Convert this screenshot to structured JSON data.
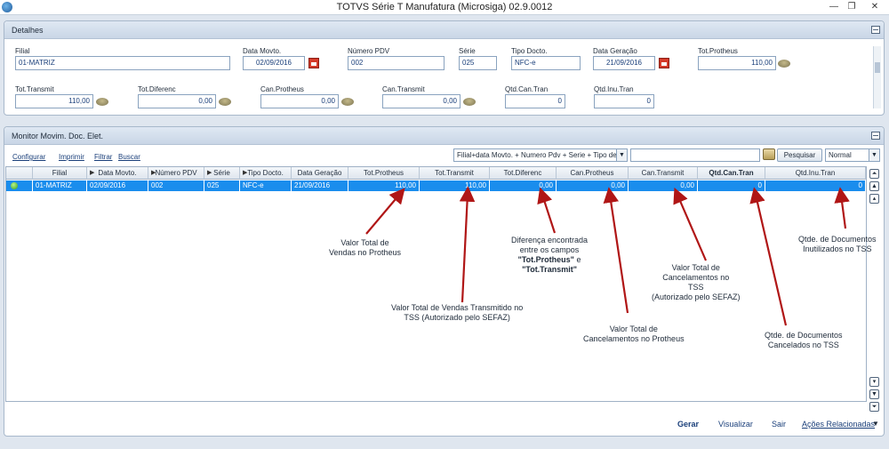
{
  "window": {
    "title": "TOTVS Série T Manufatura (Microsiga) 02.9.0012",
    "minimize": "—",
    "restore": "❐",
    "close": "✕"
  },
  "details": {
    "title": "Detalhes",
    "fields": {
      "filial": {
        "label": "Filial",
        "value": "01-MATRIZ"
      },
      "data_movto": {
        "label": "Data Movto.",
        "value": "02/09/2016"
      },
      "numero_pdv": {
        "label": "Número PDV",
        "value": "002"
      },
      "serie": {
        "label": "Série",
        "value": "025"
      },
      "tipo_docto": {
        "label": "Tipo Docto.",
        "value": "NFC-e"
      },
      "data_geracao": {
        "label": "Data Geração",
        "value": "21/09/2016"
      },
      "tot_protheus": {
        "label": "Tot.Protheus",
        "value": "110,00"
      },
      "tot_transmit": {
        "label": "Tot.Transmit",
        "value": "110,00"
      },
      "tot_diferenc": {
        "label": "Tot.Diferenc",
        "value": "0,00"
      },
      "can_protheus": {
        "label": "Can.Protheus",
        "value": "0,00"
      },
      "can_transmit": {
        "label": "Can.Transmit",
        "value": "0,00"
      },
      "qtd_can_tran": {
        "label": "Qtd.Can.Tran",
        "value": "0"
      },
      "qtd_inu_tran": {
        "label": "Qtd.Inu.Tran",
        "value": "0"
      }
    }
  },
  "monitor": {
    "title": "Monitor Movim. Doc. Elet.",
    "links": [
      "Configurar",
      "Imprimir",
      "Filtrar",
      "Buscar"
    ],
    "index_select": "Filial+data Movto. + Numero Pdv + Serie + Tipo de Do",
    "search_value": "",
    "search_button": "Pesquisar",
    "view_select": "Normal",
    "columns": [
      "Filial",
      "Data Movto.",
      "Número PDV",
      "Série",
      "Tipo Docto.",
      "Data Geração",
      "Tot.Protheus",
      "Tot.Transmit",
      "Tot.Diferenc",
      "Can.Protheus",
      "Can.Transmit",
      "Qtd.Can.Tran",
      "Qtd.Inu.Tran"
    ],
    "rows": [
      [
        "01-MATRIZ",
        "02/09/2016",
        "002",
        "025",
        "NFC-e",
        "21/09/2016",
        "110,00",
        "110,00",
        "0,00",
        "0,00",
        "0,00",
        "0",
        "0"
      ]
    ]
  },
  "annotations": {
    "a1": [
      "Valor Total de",
      "Vendas no Protheus"
    ],
    "a2": [
      "Valor Total de Vendas Transmitido no",
      "TSS (Autorizado pelo SEFAZ)"
    ],
    "a3": {
      "l1": "Diferença encontrada",
      "l2": "entre os campos",
      "l3a": "\"Tot.Protheus\"",
      "l3b": " e",
      "l4": "\"Tot.Transmit\""
    },
    "a4": [
      "Valor Total de",
      "Cancelamentos no Protheus"
    ],
    "a5": [
      "Valor Total de",
      "Cancelamentos no",
      "TSS",
      "(Autorizado pelo SEFAZ)"
    ],
    "a6": [
      "Qtde. de Documentos",
      "Cancelados no TSS"
    ],
    "a7": [
      "Qtde. de Documentos",
      "Inutilizados no TSS"
    ]
  },
  "footer": {
    "gerar": "Gerar",
    "visualizar": "Visualizar",
    "sair": "Sair",
    "acoes": "Ações Relacionadas"
  }
}
